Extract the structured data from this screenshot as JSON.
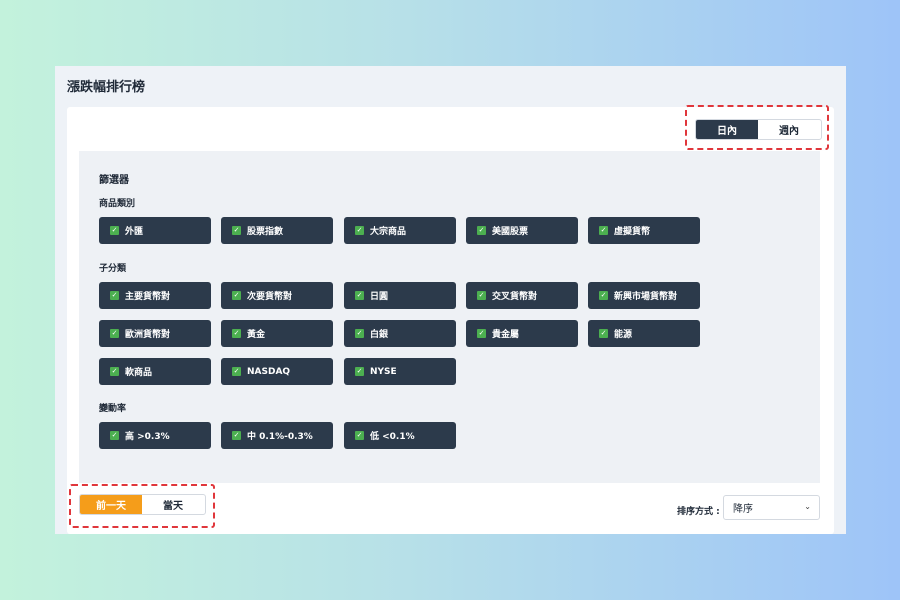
{
  "page": {
    "title": "漲跌幅排行榜"
  },
  "period_toggle": {
    "options": [
      "日內",
      "週內"
    ],
    "active": "日內"
  },
  "filter": {
    "title": "篩選器",
    "sections": [
      {
        "label": "商品類別",
        "chips": [
          "外匯",
          "股票指數",
          "大宗商品",
          "美國股票",
          "虛擬貨幣"
        ]
      },
      {
        "label": "子分類",
        "chips": [
          "主要貨幣對",
          "次要貨幣對",
          "日圓",
          "交叉貨幣對",
          "新興市場貨幣對",
          "歐洲貨幣對",
          "黃金",
          "白銀",
          "貴金屬",
          "能源",
          "軟商品",
          "NASDAQ",
          "NYSE"
        ]
      },
      {
        "label": "變動率",
        "chips": [
          "高 >0.3%",
          "中 0.1%-0.3%",
          "低 <0.1%"
        ]
      }
    ]
  },
  "day_toggle": {
    "options": [
      "前一天",
      "當天"
    ],
    "active": "前一天"
  },
  "sort": {
    "label": "排序方式 :",
    "value": "降序"
  },
  "colors": {
    "chip_bg": "#2c3a4b",
    "check_green": "#4caf50",
    "accent_orange": "#f59d1a",
    "highlight_red": "#e0363b"
  }
}
